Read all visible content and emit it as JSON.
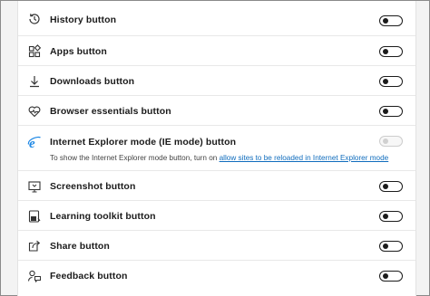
{
  "rows": [
    {
      "label": "History button",
      "icon": "history-icon",
      "enabled": false
    },
    {
      "label": "Apps button",
      "icon": "apps-icon",
      "enabled": false
    },
    {
      "label": "Downloads button",
      "icon": "download-icon",
      "enabled": false
    },
    {
      "label": "Browser essentials button",
      "icon": "heart-pulse-icon",
      "enabled": false
    },
    {
      "label": "Internet Explorer mode (IE mode) button",
      "icon": "internet-explorer-icon",
      "enabled": false,
      "disabled": true,
      "description": "To show the Internet Explorer mode button, turn on",
      "link": "allow sites to be reloaded in Internet Explorer mode"
    },
    {
      "label": "Screenshot button",
      "icon": "screenshot-icon",
      "enabled": false
    },
    {
      "label": "Learning toolkit button",
      "icon": "learning-toolkit-icon",
      "enabled": false
    },
    {
      "label": "Share button",
      "icon": "share-icon",
      "enabled": false
    },
    {
      "label": "Feedback button",
      "icon": "feedback-icon",
      "enabled": false
    }
  ],
  "colors": {
    "link": "#0f6cbd",
    "ie_blue": "#1e88e5"
  }
}
